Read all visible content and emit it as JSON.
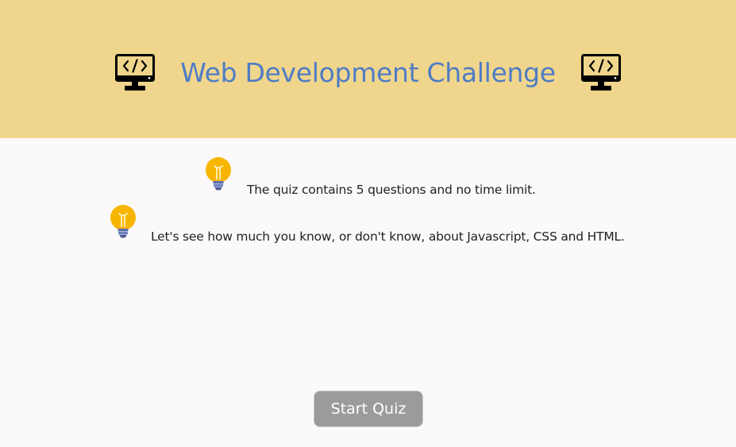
{
  "header": {
    "title": "Web Development Challenge",
    "background_color": "#f0d68c",
    "title_color": "#4f7cc4",
    "left_icon": "monitor-code-icon",
    "right_icon": "monitor-code-icon"
  },
  "intro": {
    "icon": "lightbulb-icon",
    "lines": [
      "The quiz contains 5 questions and no time limit.",
      "Let's see how much you know, or don't know, about Javascript, CSS and HTML."
    ]
  },
  "actions": {
    "start_label": "Start Quiz",
    "button_color": "#9b9b9b"
  }
}
